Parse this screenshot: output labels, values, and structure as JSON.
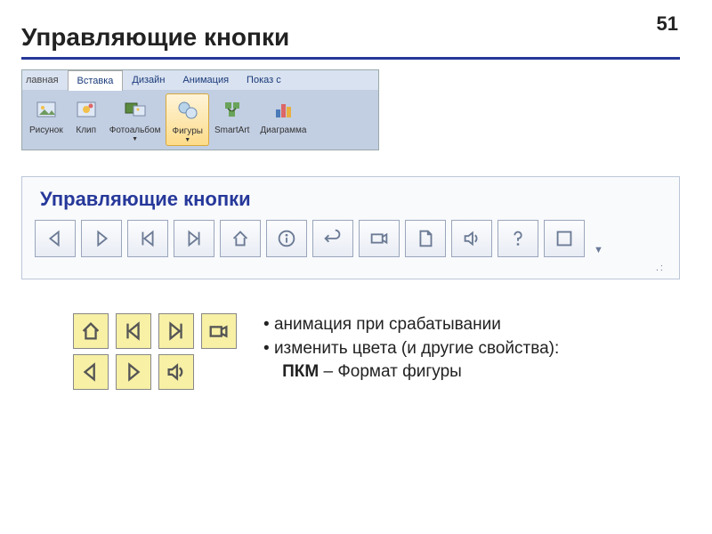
{
  "page_number": "51",
  "page_title": "Управляющие кнопки",
  "tabs": {
    "clip_prefix": "лавная",
    "active": "Вставка",
    "other": [
      "Дизайн",
      "Анимация",
      "Показ с"
    ]
  },
  "ribbon_buttons": [
    {
      "label": "Рисунок",
      "icon": "picture"
    },
    {
      "label": "Клип",
      "icon": "clip"
    },
    {
      "label": "Фотоальбом",
      "icon": "album",
      "dropdown": true
    },
    {
      "label": "Фигуры",
      "icon": "shapes",
      "dropdown": true,
      "active": true
    },
    {
      "label": "SmartArt",
      "icon": "smartart"
    },
    {
      "label": "Диаграмма",
      "icon": "chart"
    }
  ],
  "panel_title": "Управляющие кнопки",
  "action_buttons": [
    "back",
    "forward",
    "first",
    "last",
    "home",
    "info",
    "return",
    "movie",
    "document",
    "sound",
    "help",
    "custom"
  ],
  "yellow_top": [
    "home",
    "first",
    "last",
    "movie"
  ],
  "yellow_bottom": [
    "back",
    "forward",
    "sound"
  ],
  "notes": {
    "line1": "анимация при срабатывании",
    "line2": "изменить цвета (и другие свойства):",
    "label_bold": "ПКМ",
    "label_rest": " – Формат фигуры"
  }
}
